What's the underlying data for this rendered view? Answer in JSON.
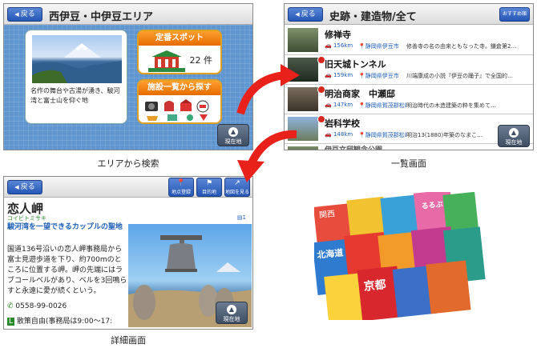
{
  "screen_area": {
    "back_label": "戻る",
    "title": "西伊豆・中伊豆エリア",
    "photo_caption": "名作の舞台や古湯が湧き、駿河湾と富士山を仰ぐ地",
    "spot_card": {
      "header": "定番スポット",
      "count": "22 件"
    },
    "facility_card": {
      "header": "施設一覧から探す"
    },
    "current_location_label": "現在地",
    "caption": "エリアから検索"
  },
  "screen_list": {
    "back_label": "戻る",
    "title": "史跡・建造物/全て",
    "recommend_label": "おすすめ順",
    "rows": [
      {
        "name": "修禅寺",
        "dist": "156km",
        "pref": "静岡県伊豆市",
        "desc": "修善寺の名の由来ともなった寺。鎌倉第2…"
      },
      {
        "name": "旧天城トンネル",
        "dist": "159km",
        "pref": "静岡県伊豆市",
        "desc": "川端康成の小説『伊豆の踊子』で全国的…"
      },
      {
        "name": "明治商家　中瀬邸",
        "dist": "147km",
        "pref": "静岡県賀茂郡松崎町",
        "desc": "明治時代の木造建築の粋を集めて…"
      },
      {
        "name": "岩科学校",
        "dist": "148km",
        "pref": "静岡県賀茂郡松崎町",
        "desc": "明治13(1880)年築のなまこ…"
      },
      {
        "name": "伊豆文邸観念公園",
        "dist": "",
        "pref": "",
        "desc": ""
      }
    ],
    "current_location_label": "現在地",
    "caption": "一覧画面"
  },
  "screen_detail": {
    "back_label": "戻る",
    "buttons": [
      "地点登録",
      "目的地",
      "地図を見る"
    ],
    "title": "恋人岬",
    "kana": "コイビトミサキ",
    "page": "1",
    "catch": "駿河湾を一望できるカップルの聖地",
    "text": "国道136号沿いの恋人岬事務局から富士見遊歩道を下り、約700mのところに位置する岬。岬の先端にはラブコールベルがあり、ベルを3回鳴らすと永遠に愛が続くという。",
    "tel": "0558-99-0026",
    "hours": "散策自由(事務局は9:00～17:",
    "current_location_label": "現在地",
    "caption": "詳細画面"
  },
  "colors": {
    "accent_blue": "#2456b5",
    "area_bg": "#5f96d0",
    "orange": "#e66b00",
    "link_blue": "#1f5fb8",
    "arrow_red": "#e8221a"
  },
  "magazines": {
    "cover_titles": [
      "関西",
      "北海道",
      "京都",
      "るるぶ"
    ]
  }
}
